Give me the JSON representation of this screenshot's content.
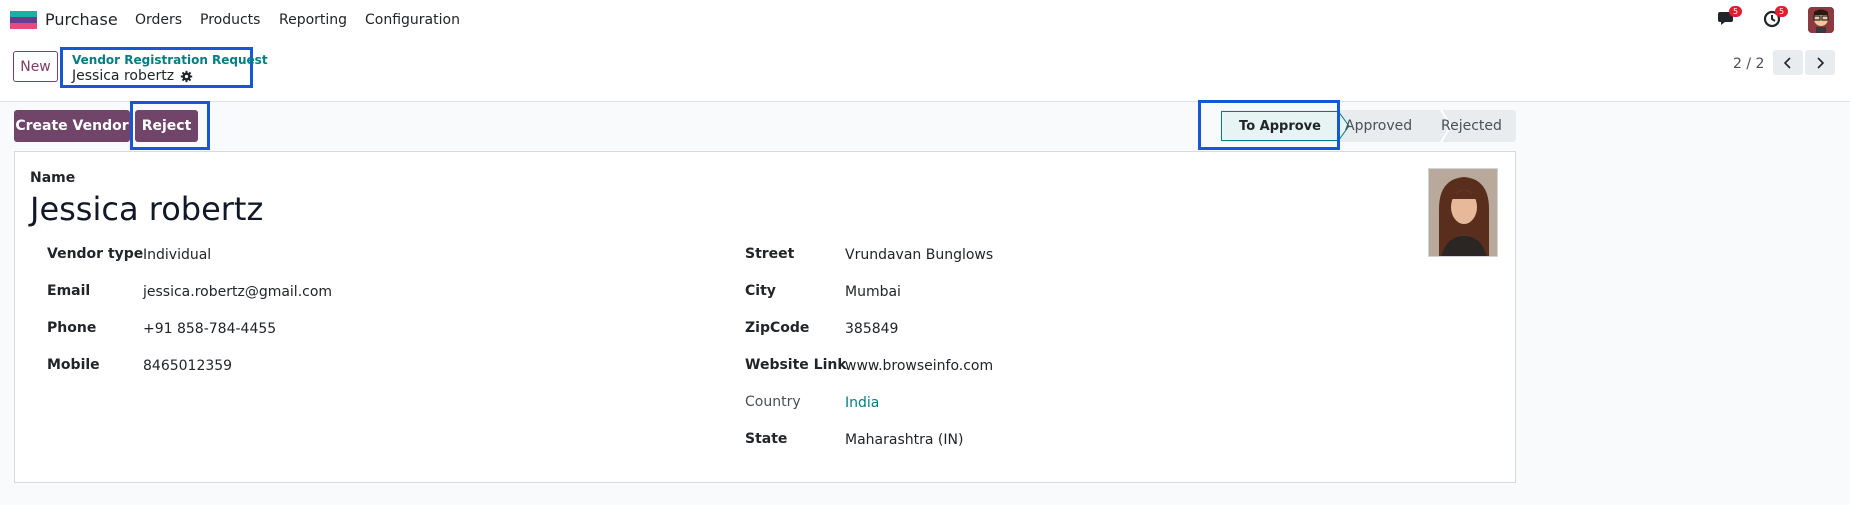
{
  "navbar": {
    "app_name": "Purchase",
    "menu": [
      "Orders",
      "Products",
      "Reporting",
      "Configuration"
    ],
    "messages_count": "5",
    "activities_count": "5"
  },
  "control": {
    "new_label": "New",
    "breadcrumb_parent": "Vendor Registration Request",
    "breadcrumb_current": "Jessica robertz",
    "pager_value": "2 / 2"
  },
  "actions": {
    "create_vendor": "Create Vendor",
    "reject": "Reject"
  },
  "status": {
    "stages": [
      "To Approve",
      "Approved",
      "Rejected"
    ],
    "current": "To Approve"
  },
  "form": {
    "name_label": "Name",
    "name_value": "Jessica robertz",
    "left": [
      {
        "label": "Vendor type",
        "value": "Individual"
      },
      {
        "label": "Email",
        "value": "jessica.robertz@gmail.com"
      },
      {
        "label": "Phone",
        "value": "+91 858-784-4455"
      },
      {
        "label": "Mobile",
        "value": "8465012359"
      }
    ],
    "right": [
      {
        "label": "Street",
        "value": "Vrundavan Bunglows"
      },
      {
        "label": "City",
        "value": "Mumbai"
      },
      {
        "label": "ZipCode",
        "value": "385849"
      },
      {
        "label": "Website Link",
        "value": "www.browseinfo.com"
      },
      {
        "label": "Country",
        "value": "India"
      },
      {
        "label": "State",
        "value": "Maharashtra (IN)"
      }
    ]
  },
  "colors": {
    "brand": "#71456a",
    "link": "#017e84",
    "highlight": "#1558d6",
    "badge": "#e01e2f"
  }
}
